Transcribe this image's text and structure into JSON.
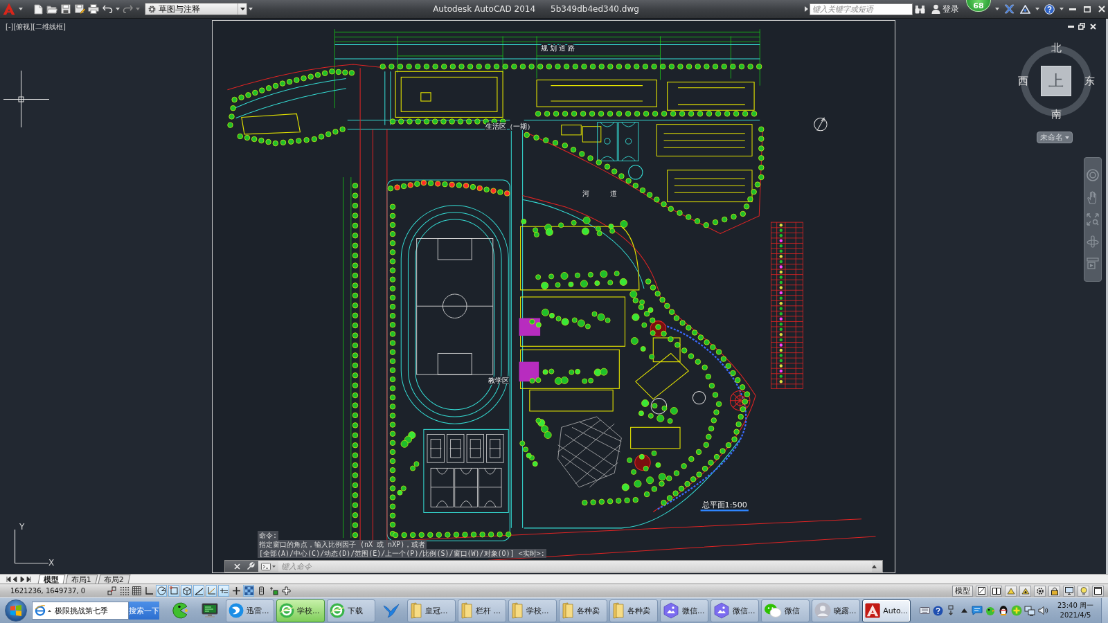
{
  "title_bar": {
    "workspace": "草图与注释",
    "app_name": "Autodesk AutoCAD 2014",
    "file_name": "5b349db4ed340.dwg",
    "search": {
      "placeholder": "键入关键字或短语"
    },
    "sign_in": "登录",
    "notification_count": "68"
  },
  "viewport": {
    "label": "[-][俯视][二维线框]",
    "ucs": {
      "x_label": "X",
      "y_label": "Y"
    }
  },
  "drawing": {
    "labels": [
      {
        "kind": "road",
        "text": "规 划 道 路"
      },
      {
        "kind": "zone",
        "text": "生活区（一期）"
      },
      {
        "kind": "river",
        "text": "河"
      },
      {
        "kind": "river",
        "text": "道"
      },
      {
        "kind": "zone",
        "text": "教学区"
      },
      {
        "kind": "title",
        "text": "总平面1:500"
      }
    ]
  },
  "viewcube": {
    "north": "北",
    "west": "西",
    "east": "东",
    "south": "南",
    "face": "上",
    "ucs_menu": "未命名"
  },
  "command_line": {
    "history": [
      "命令:",
      "指定窗口的角点，输入比例因子 (nX 或 nXP)，或者",
      "[全部(A)/中心(C)/动态(D)/范围(E)/上一个(P)/比例(S)/窗口(W)/对象(O)] <实时>:"
    ],
    "placeholder": "键入命令"
  },
  "layout_tabs": [
    {
      "label": "模型",
      "selected": true
    },
    {
      "label": "布局1",
      "selected": false
    },
    {
      "label": "布局2",
      "selected": false
    }
  ],
  "status_bar": {
    "coordinates": "1621236, 1649737, 0",
    "toggles": [
      {
        "kind": "infer",
        "on": false
      },
      {
        "kind": "snap",
        "on": false
      },
      {
        "kind": "grid",
        "on": false
      },
      {
        "kind": "ortho",
        "on": false
      },
      {
        "kind": "polar",
        "on": true
      },
      {
        "kind": "osnap",
        "on": true
      },
      {
        "kind": "osnap3d",
        "on": true
      },
      {
        "kind": "otrack",
        "on": true
      },
      {
        "kind": "ducs",
        "on": true
      },
      {
        "kind": "dyn",
        "on": true
      },
      {
        "kind": "lineweight",
        "on": false
      },
      {
        "kind": "transparency",
        "on": true
      },
      {
        "kind": "quickprops",
        "on": false
      },
      {
        "kind": "cycling",
        "on": false
      },
      {
        "kind": "annomonitor",
        "on": false
      }
    ],
    "space_button": "模型"
  },
  "taskbar": {
    "search": {
      "value": "极限挑战第七季"
    },
    "search_button": "搜索一下",
    "items": [
      {
        "kind": "pacman",
        "selected": false,
        "flashing": false
      },
      {
        "kind": "monitor",
        "selected": false,
        "flashing": false
      },
      {
        "kind": "swoosh",
        "label": "迅雷...",
        "selected": false,
        "flashing": false
      },
      {
        "kind": "browser",
        "label": "学校...",
        "selected": false,
        "flashing": true
      },
      {
        "kind": "browser",
        "label": "下载",
        "selected": false,
        "flashing": false
      },
      {
        "kind": "bird",
        "selected": false,
        "flashing": false
      },
      {
        "kind": "folder",
        "label": "皇冠...",
        "selected": false,
        "flashing": false
      },
      {
        "kind": "folder",
        "label": "栏杆 ...",
        "selected": false,
        "flashing": false
      },
      {
        "kind": "folder",
        "label": "学校...",
        "selected": false,
        "flashing": false
      },
      {
        "kind": "folder",
        "label": "各种卖",
        "selected": false,
        "flashing": false
      },
      {
        "kind": "folder",
        "label": "各种卖",
        "selected": false,
        "flashing": false
      },
      {
        "kind": "photos",
        "label": "微信...",
        "selected": false,
        "flashing": false
      },
      {
        "kind": "photos",
        "label": "微信...",
        "selected": false,
        "flashing": false
      },
      {
        "kind": "chat",
        "label": "微信",
        "selected": false,
        "flashing": false
      },
      {
        "kind": "avatar",
        "label": "晓露...",
        "selected": false,
        "flashing": false
      },
      {
        "kind": "cad",
        "label": "Auto...",
        "selected": true,
        "flashing": false
      }
    ],
    "clock": {
      "time": "23:40 周一",
      "date": "2021/4/5"
    }
  }
}
